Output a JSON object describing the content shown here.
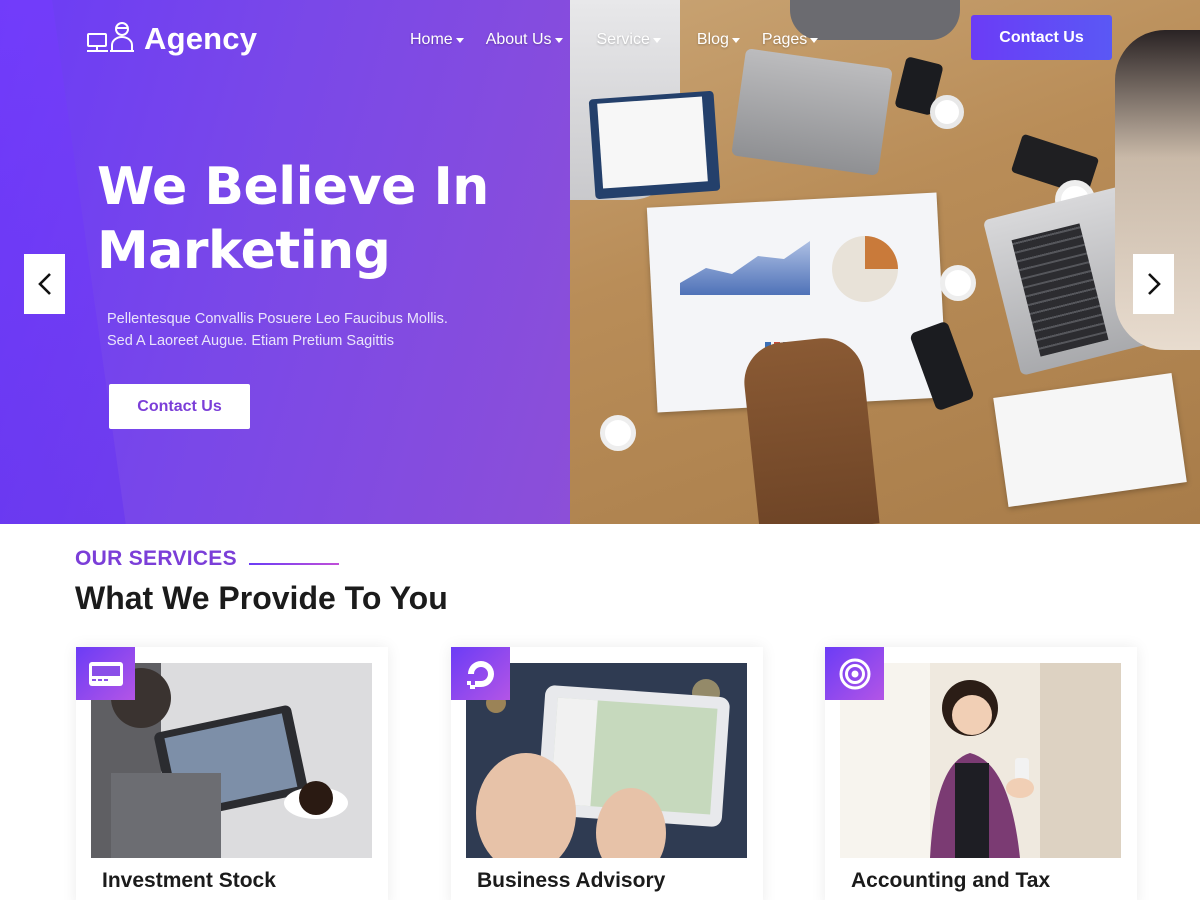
{
  "brand": {
    "name": "Agency",
    "logo_icon": "agent-desk-icon"
  },
  "nav": {
    "items": [
      {
        "label": "Home",
        "has_dropdown": true
      },
      {
        "label": "About Us",
        "has_dropdown": true
      },
      {
        "label": "Service",
        "has_dropdown": true
      },
      {
        "label": "Blog",
        "has_dropdown": true
      },
      {
        "label": "Pages",
        "has_dropdown": true
      }
    ],
    "cta_label": "Contact Us"
  },
  "hero": {
    "title": "We Believe In Marketing",
    "subtitle": "Pellentesque Convallis Posuere Leo Faucibus Mollis. Sed A Laoreet Augue. Etiam Pretium Sagittis",
    "cta_label": "Contact Us",
    "prev_icon": "chevron-left-icon",
    "next_icon": "chevron-right-icon"
  },
  "services": {
    "eyebrow": "OUR SERVICES",
    "title": "What We Provide To You",
    "cards": [
      {
        "title": "Investment Stock",
        "icon": "credit-card-icon"
      },
      {
        "title": "Business Advisory",
        "icon": "digitalocean-icon"
      },
      {
        "title": "Accounting and Tax",
        "icon": "target-icon"
      }
    ]
  },
  "colors": {
    "primary": "#6b3cf6",
    "accent": "#7b3ed8",
    "gradient_end": "#b355e6",
    "text_dark": "#1b1b1b"
  }
}
